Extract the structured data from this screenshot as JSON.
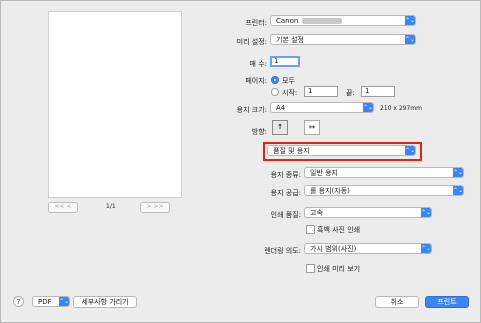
{
  "printer": {
    "label": "프린터:",
    "value": "Canon"
  },
  "presets": {
    "label": "미리 설정:",
    "value": "기본 설정"
  },
  "copies": {
    "label": "매 수:",
    "value": "1"
  },
  "pages": {
    "label": "페이지:",
    "all": "모두",
    "from_label": "시작:",
    "from_value": "1",
    "to_label": "끝:",
    "to_value": "1"
  },
  "paper_size": {
    "label": "용지 크기:",
    "value": "A4",
    "dimensions": "210 x 297mm"
  },
  "orientation": {
    "label": "방향:",
    "portrait_glyph": "↑",
    "landscape_glyph": "↦"
  },
  "section_menu": {
    "value": "품질 및 용지"
  },
  "media_type": {
    "label": "용지 종류:",
    "value": "일반 용지"
  },
  "paper_source": {
    "label": "용지 공급:",
    "value": "롤 용지(자동)"
  },
  "print_quality": {
    "label": "인쇄 품질:",
    "value": "고속"
  },
  "grayscale": {
    "label": "흑백 사진 인쇄"
  },
  "rendering_intent": {
    "label": "렌더링 의도:",
    "value": "가시 범위(사진)"
  },
  "print_preview": {
    "label": "인쇄 미리 보기"
  },
  "preview_nav": {
    "first": "<< ",
    "prev": "<",
    "page_indicator": "1/1",
    "next": ">",
    "last": ">>"
  },
  "footer": {
    "help": "?",
    "pdf": "PDF",
    "details": "세부사항 가리기",
    "cancel": "취소",
    "print": "프린트"
  },
  "icons": {
    "chevron": "⌃⌄"
  },
  "colors": {
    "accent": "#3d86f0",
    "highlight": "#e2231a"
  }
}
